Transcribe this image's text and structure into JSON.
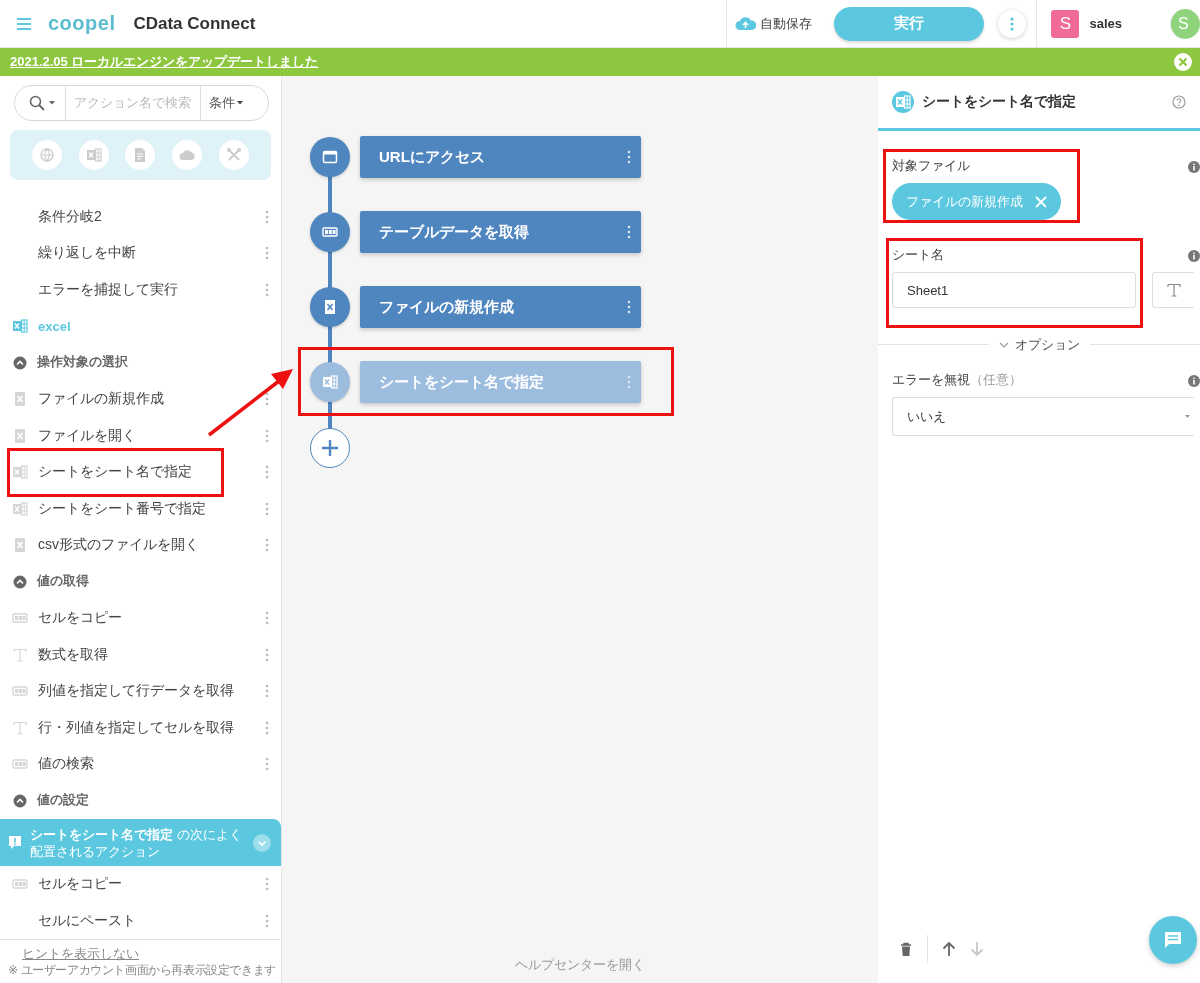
{
  "header": {
    "logo": "coopel",
    "app_name": "CData Connect",
    "autosave": "自動保存",
    "run_button": "実行",
    "user": {
      "initial": "S",
      "name": "sales",
      "color": "#f06a9a"
    },
    "second_avatar": {
      "initial": "S",
      "color": "#8fd47c"
    }
  },
  "banner": {
    "text": "2021.2.05 ローカルエンジンをアップデートしました"
  },
  "sidebar": {
    "search": {
      "placeholder": "アクション名で検索"
    },
    "filter": "条件",
    "items": [
      {
        "kind": "action",
        "label": "条件分岐2",
        "highlighted": false
      },
      {
        "kind": "action",
        "label": "繰り返しを中断",
        "highlighted": false
      },
      {
        "kind": "action",
        "label": "エラーを捕捉して実行",
        "highlighted": false
      },
      {
        "kind": "category",
        "label": "excel"
      },
      {
        "kind": "section",
        "label": "操作対象の選択"
      },
      {
        "kind": "file-action",
        "label": "ファイルの新規作成",
        "highlighted": false
      },
      {
        "kind": "file-action",
        "label": "ファイルを開く",
        "highlighted": false
      },
      {
        "kind": "sheet-action",
        "label": "シートをシート名で指定",
        "highlighted": true
      },
      {
        "kind": "sheet-action",
        "label": "シートをシート番号で指定",
        "highlighted": false
      },
      {
        "kind": "file-action",
        "label": "csv形式のファイルを開く",
        "highlighted": false
      },
      {
        "kind": "section",
        "label": "値の取得"
      },
      {
        "kind": "table-action",
        "label": "セルをコピー",
        "highlighted": false
      },
      {
        "kind": "text-action",
        "label": "数式を取得",
        "highlighted": false
      },
      {
        "kind": "table-action",
        "label": "列値を指定して行データを取得",
        "highlighted": false
      },
      {
        "kind": "text-action",
        "label": "行・列値を指定してセルを取得",
        "highlighted": false
      },
      {
        "kind": "table-action",
        "label": "値の検索",
        "highlighted": false
      },
      {
        "kind": "section",
        "label": "値の設定"
      }
    ],
    "hint": {
      "title": "**シートをシート名で指定** の次によく配置されるアクション",
      "items": [
        {
          "kind": "table-action",
          "label": "セルをコピー"
        },
        {
          "kind": "action",
          "label": "セルにペースト"
        }
      ],
      "hide_link": "ヒントを表示しない",
      "note": "※ ユーザーアカウント画面から再表示設定できます"
    }
  },
  "canvas": {
    "steps": [
      {
        "kind": "browser",
        "label": "URLにアクセス",
        "dimmed": false,
        "highlighted": false
      },
      {
        "kind": "table",
        "label": "テーブルデータを取得",
        "dimmed": false,
        "highlighted": false
      },
      {
        "kind": "file",
        "label": "ファイルの新規作成",
        "dimmed": false,
        "highlighted": false
      },
      {
        "kind": "sheet",
        "label": "シートをシート名で指定",
        "dimmed": true,
        "highlighted": true
      }
    ],
    "help_link": "ヘルプセンターを開く"
  },
  "annotation_arrow": true,
  "panel": {
    "title": "シートをシート名で指定",
    "fields": [
      {
        "kind": "chip",
        "label": "対象ファイル",
        "value": "ファイルの新規作成",
        "highlighted": true
      },
      {
        "kind": "text",
        "label": "シート名",
        "value": "Sheet1",
        "highlighted": true
      }
    ],
    "options_label": "オプション",
    "option_fields": [
      {
        "kind": "select",
        "label": "エラーを無視",
        "note": "（任意）",
        "value": "いいえ"
      }
    ],
    "toolbar": [
      {
        "kind": "delete",
        "disabled": false
      },
      {
        "kind": "up",
        "disabled": false
      },
      {
        "kind": "down",
        "disabled": true
      }
    ]
  }
}
